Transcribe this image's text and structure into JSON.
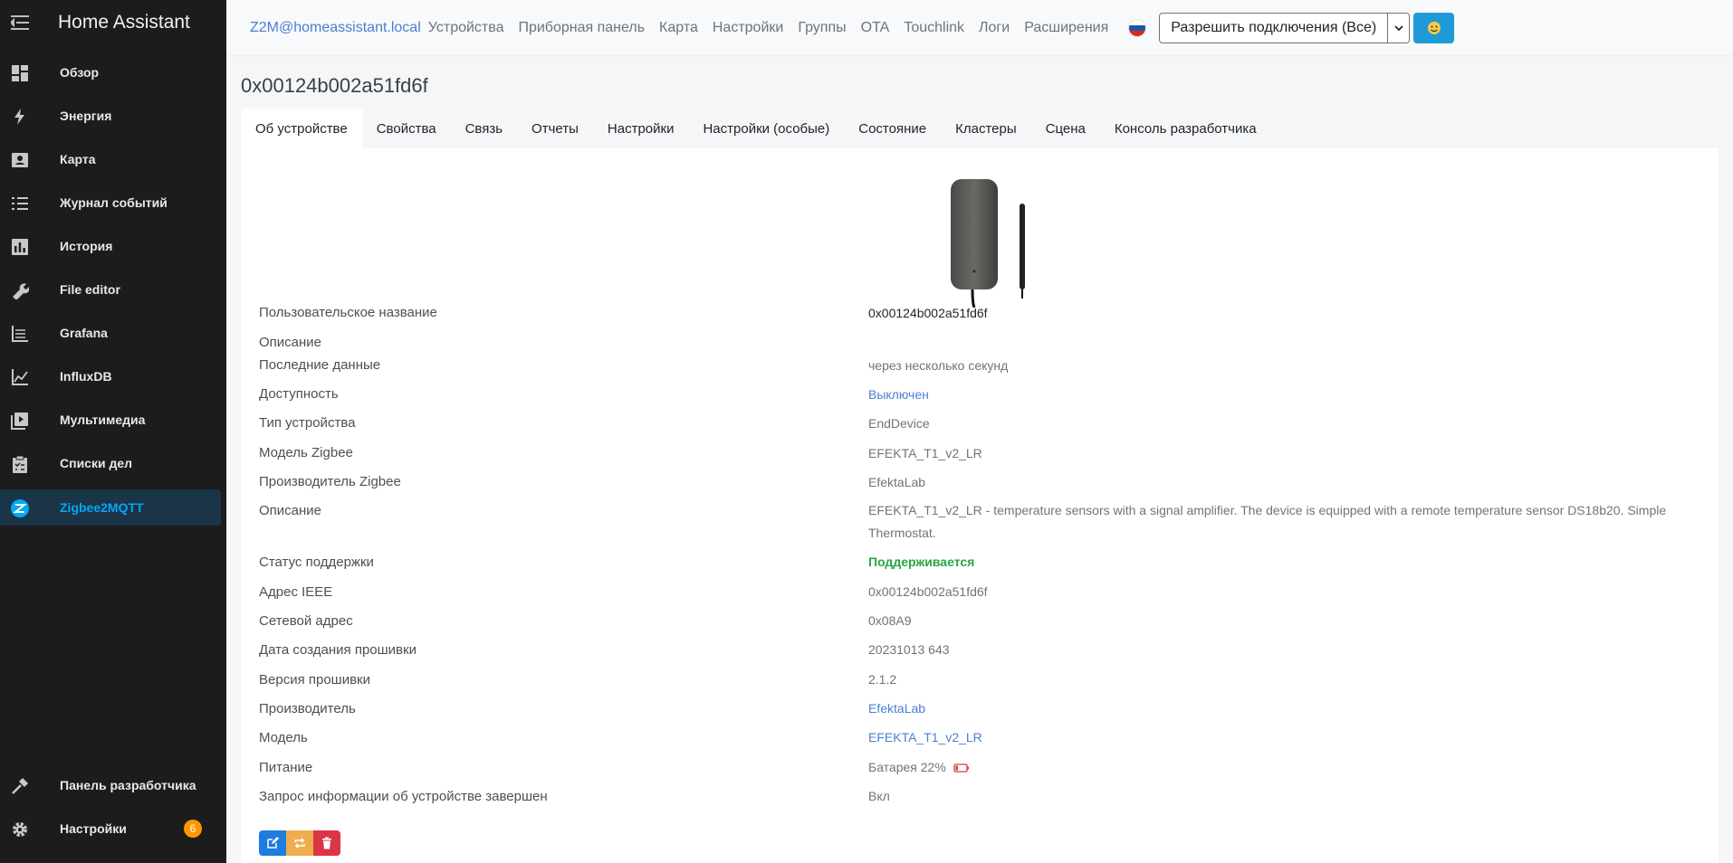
{
  "app": {
    "title": "Home Assistant"
  },
  "sidebar": {
    "items": [
      {
        "label": "Обзор",
        "icon": "dashboard-icon"
      },
      {
        "label": "Энергия",
        "icon": "lightning-icon"
      },
      {
        "label": "Карта",
        "icon": "map-person-icon"
      },
      {
        "label": "Журнал событий",
        "icon": "list-icon"
      },
      {
        "label": "История",
        "icon": "chart-bar-icon"
      },
      {
        "label": "File editor",
        "icon": "wrench-icon"
      },
      {
        "label": "Grafana",
        "icon": "chart-line-icon"
      },
      {
        "label": "InfluxDB",
        "icon": "chart-area-icon"
      },
      {
        "label": "Мультимедиа",
        "icon": "play-box-icon"
      },
      {
        "label": "Списки дел",
        "icon": "clipboard-icon"
      },
      {
        "label": "Zigbee2MQTT",
        "icon": "zigbee-icon"
      }
    ],
    "bottom": [
      {
        "label": "Панель разработчика",
        "icon": "hammer-icon"
      },
      {
        "label": "Настройки",
        "icon": "gear-icon",
        "badge": "6"
      }
    ],
    "active_color": "#03a9f4"
  },
  "topnav": {
    "brand": "Z2M@homeassistant.local",
    "links": [
      "Устройства",
      "Приборная панель",
      "Карта",
      "Настройки",
      "Группы",
      "OTA",
      "Touchlink",
      "Логи",
      "Расширения"
    ],
    "permit_join": "Разрешить подключения (Все)"
  },
  "device": {
    "title": "0x00124b002a51fd6f",
    "tabs": [
      "Об устройстве",
      "Свойства",
      "Связь",
      "Отчеты",
      "Настройки",
      "Настройки (особые)",
      "Состояние",
      "Кластеры",
      "Сцена",
      "Консоль разработчика"
    ],
    "rows": [
      {
        "label": "Пользовательское название",
        "value": "0x00124b002a51fd6f"
      },
      {
        "label": "Описание",
        "value": ""
      },
      {
        "label": "Последние данные",
        "value": "через несколько секунд"
      },
      {
        "label": "Доступность",
        "value": "Выключен"
      },
      {
        "label": "Тип устройства",
        "value": "EndDevice"
      },
      {
        "label": "Модель Zigbee",
        "value": "EFEKTA_T1_v2_LR"
      },
      {
        "label": "Производитель Zigbee",
        "value": "EfektaLab"
      },
      {
        "label": "Описание",
        "value": "EFEKTA_T1_v2_LR - temperature sensors with a signal amplifier. The device is equipped with a remote temperature sensor DS18b20. Simple Thermostat."
      },
      {
        "label": "Статус поддержки",
        "value": "Поддерживается"
      },
      {
        "label": "Адрес IEEE",
        "value": "0x00124b002a51fd6f"
      },
      {
        "label": "Сетевой адрес",
        "value": "0x08A9"
      },
      {
        "label": "Дата создания прошивки",
        "value": "20231013 643"
      },
      {
        "label": "Версия прошивки",
        "value": "2.1.2"
      },
      {
        "label": "Производитель",
        "value": "EfektaLab"
      },
      {
        "label": "Модель",
        "value": "EFEKTA_T1_v2_LR"
      },
      {
        "label": "Питание",
        "value": "Батарея 22%",
        "battery_level": 0.22
      },
      {
        "label": "Запрос информации об устройстве завершен",
        "value": "Вкл"
      }
    ]
  },
  "colors": {
    "link": "#4a7fd0",
    "supported": "#28a745",
    "battery_low": "#dc3545"
  }
}
